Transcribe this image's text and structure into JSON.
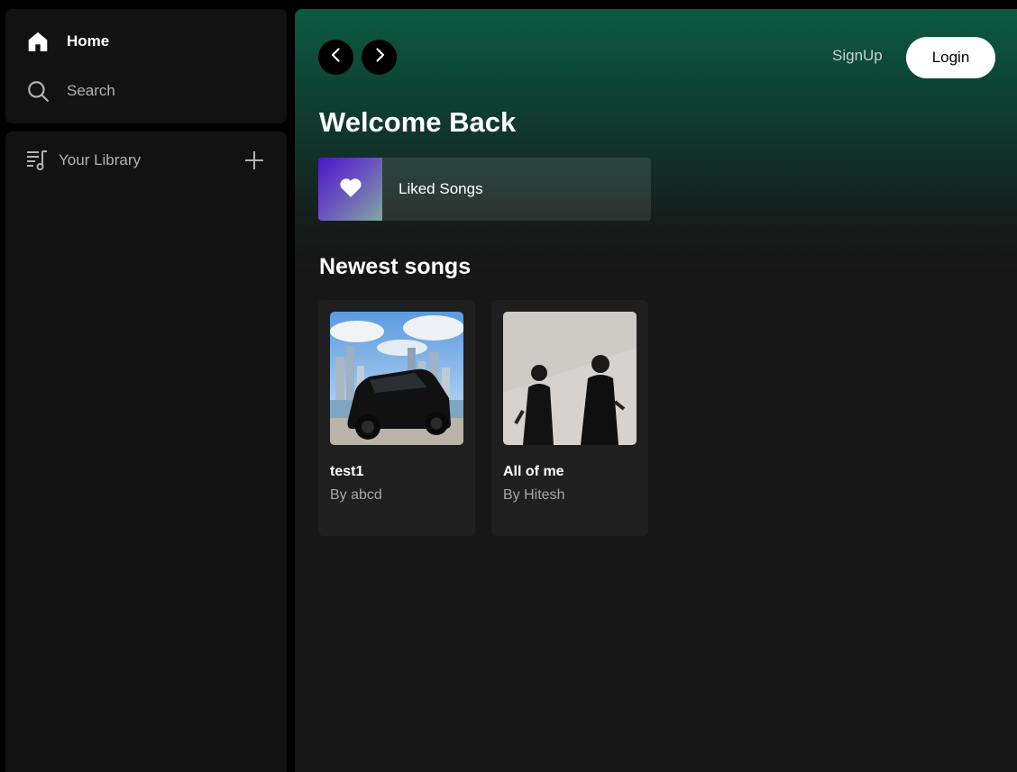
{
  "sidebar": {
    "nav": [
      {
        "label": "Home",
        "icon": "home-icon"
      },
      {
        "label": "Search",
        "icon": "search-icon"
      }
    ],
    "library": {
      "label": "Your Library",
      "icon": "library-icon",
      "add_icon": "plus-icon"
    }
  },
  "header": {
    "back_icon": "chevron-left-icon",
    "forward_icon": "chevron-right-icon",
    "signup_label": "SignUp",
    "login_label": "Login"
  },
  "main": {
    "welcome": "Welcome Back",
    "liked": {
      "label": "Liked Songs",
      "icon": "heart-icon"
    },
    "section_title": "Newest songs",
    "songs": [
      {
        "title": "test1",
        "artist": "By abcd",
        "art": "black SUV in front of city skyline"
      },
      {
        "title": "All of me",
        "artist": "By Hitesh",
        "art": "two people in black against grey wall"
      }
    ]
  },
  "colors": {
    "accent_green": "#0b5a42",
    "panel": "#121212",
    "main_bg": "#171717",
    "card": "#1f1f1f",
    "liked_gradient_start": "#4a16c9"
  }
}
